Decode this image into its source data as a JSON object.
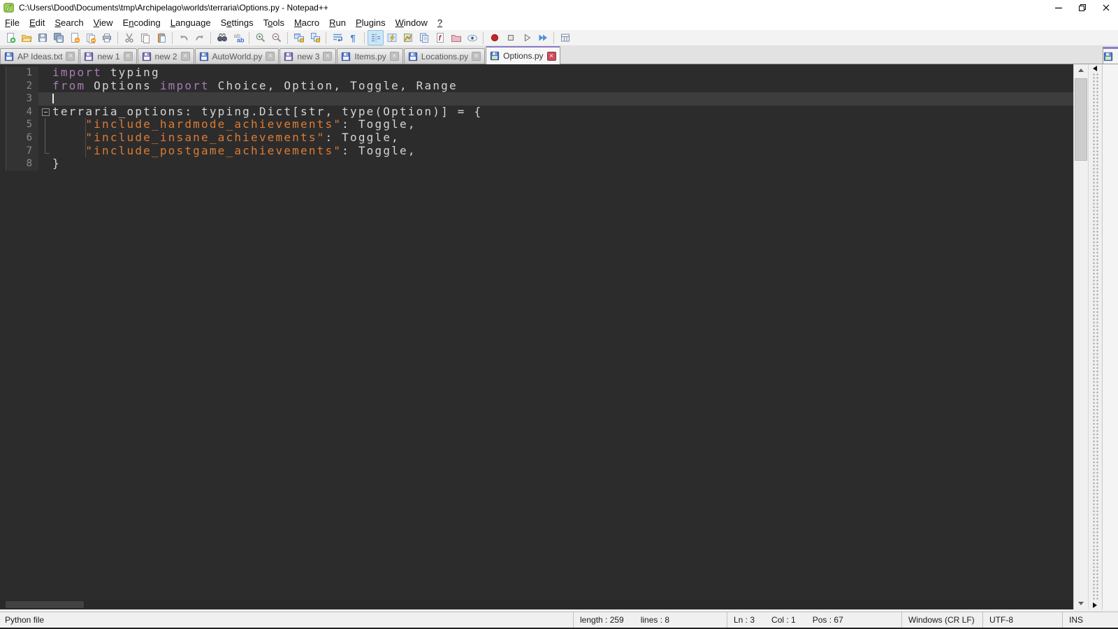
{
  "window": {
    "title": "C:\\Users\\Dood\\Documents\\tmp\\Archipelago\\worlds\\terraria\\Options.py - Notepad++",
    "controls": [
      "minimize",
      "restore",
      "close"
    ]
  },
  "menu": {
    "items": [
      {
        "label": "File",
        "u": 0
      },
      {
        "label": "Edit",
        "u": 0
      },
      {
        "label": "Search",
        "u": 0
      },
      {
        "label": "View",
        "u": 0
      },
      {
        "label": "Encoding",
        "u": 1
      },
      {
        "label": "Language",
        "u": 0
      },
      {
        "label": "Settings",
        "u": 1
      },
      {
        "label": "Tools",
        "u": 1
      },
      {
        "label": "Macro",
        "u": 0
      },
      {
        "label": "Run",
        "u": 0
      },
      {
        "label": "Plugins",
        "u": 0
      },
      {
        "label": "Window",
        "u": 0
      },
      {
        "label": "?",
        "u": 0
      }
    ]
  },
  "toolbar": {
    "items": [
      "new-file",
      "open-folder",
      "save",
      "save-all",
      "close-file",
      "close-all",
      "print",
      "|",
      "cut",
      "copy",
      "paste",
      "|",
      "undo",
      "redo",
      "|",
      "find",
      "replace",
      "|",
      "zoom-in",
      "zoom-out",
      "|",
      "sync-vertical",
      "sync-horizontal",
      "|",
      "word-wrap",
      "show-all-characters",
      "|",
      "show-indent-guide",
      "define-language",
      "document-map",
      "document-list",
      "function-list",
      "folder-as-workspace",
      "monitoring",
      "|",
      "macro-record",
      "macro-stop",
      "macro-play",
      "macro-run-multiple",
      "|",
      "macro-save"
    ],
    "pressed": [
      "show-indent-guide"
    ]
  },
  "tabs": {
    "items": [
      {
        "label": "AP Ideas.txt",
        "icon": "blue",
        "active": false
      },
      {
        "label": "new 1",
        "icon": "violet",
        "active": false
      },
      {
        "label": "new 2",
        "icon": "violet",
        "active": false
      },
      {
        "label": "AutoWorld.py",
        "icon": "blue",
        "active": false
      },
      {
        "label": "new 3",
        "icon": "violet",
        "active": false
      },
      {
        "label": "Items.py",
        "icon": "blue",
        "active": false
      },
      {
        "label": "Locations.py",
        "icon": "blue",
        "active": false
      },
      {
        "label": "Options.py",
        "icon": "blue",
        "active": true
      }
    ]
  },
  "editor": {
    "colors": {
      "background": "#2c2c2c",
      "gutter_background": "#333333",
      "current_line": "#3d3d3d",
      "keyword": "#a87bb5",
      "plain": "#d5d5d5",
      "string": "#dd7c35",
      "line_number": "#8a8a8a"
    },
    "lines": [
      {
        "n": "1",
        "tokens": [
          {
            "t": "import",
            "c": "kw"
          },
          {
            "t": " typing",
            "c": "pl"
          }
        ]
      },
      {
        "n": "2",
        "tokens": [
          {
            "t": "from",
            "c": "kw"
          },
          {
            "t": " Options ",
            "c": "pl"
          },
          {
            "t": "import",
            "c": "kw"
          },
          {
            "t": " Choice, Option, Toggle, Range",
            "c": "pl"
          }
        ]
      },
      {
        "n": "3",
        "tokens": [],
        "current": true,
        "caret": true
      },
      {
        "n": "4",
        "tokens": [
          {
            "t": "terraria_options: typing.Dict[str, type(Option)] = {",
            "c": "pl"
          }
        ],
        "fold": "box"
      },
      {
        "n": "5",
        "tokens": [
          {
            "t": "    ",
            "c": "pl"
          },
          {
            "t": "\"include_hardmode_achievements\"",
            "c": "str"
          },
          {
            "t": ": Toggle,",
            "c": "pl"
          }
        ],
        "fold": "line",
        "guide": true
      },
      {
        "n": "6",
        "tokens": [
          {
            "t": "    ",
            "c": "pl"
          },
          {
            "t": "\"include_insane_achievements\"",
            "c": "str"
          },
          {
            "t": ": Toggle,",
            "c": "pl"
          }
        ],
        "fold": "line",
        "guide": true
      },
      {
        "n": "7",
        "tokens": [
          {
            "t": "    ",
            "c": "pl"
          },
          {
            "t": "\"include_postgame_achievements\"",
            "c": "str"
          },
          {
            "t": ": Toggle,",
            "c": "pl"
          }
        ],
        "fold": "end",
        "guide": true
      },
      {
        "n": "8",
        "tokens": [
          {
            "t": "}",
            "c": "pl"
          }
        ]
      }
    ]
  },
  "status_bar": {
    "doc_type": "Python file",
    "length": "length : 259",
    "lines": "lines : 8",
    "line": "Ln : 3",
    "column": "Col : 1",
    "position": "Pos : 67",
    "eol": "Windows (CR LF)",
    "encoding": "UTF-8",
    "insert_mode": "INS"
  }
}
